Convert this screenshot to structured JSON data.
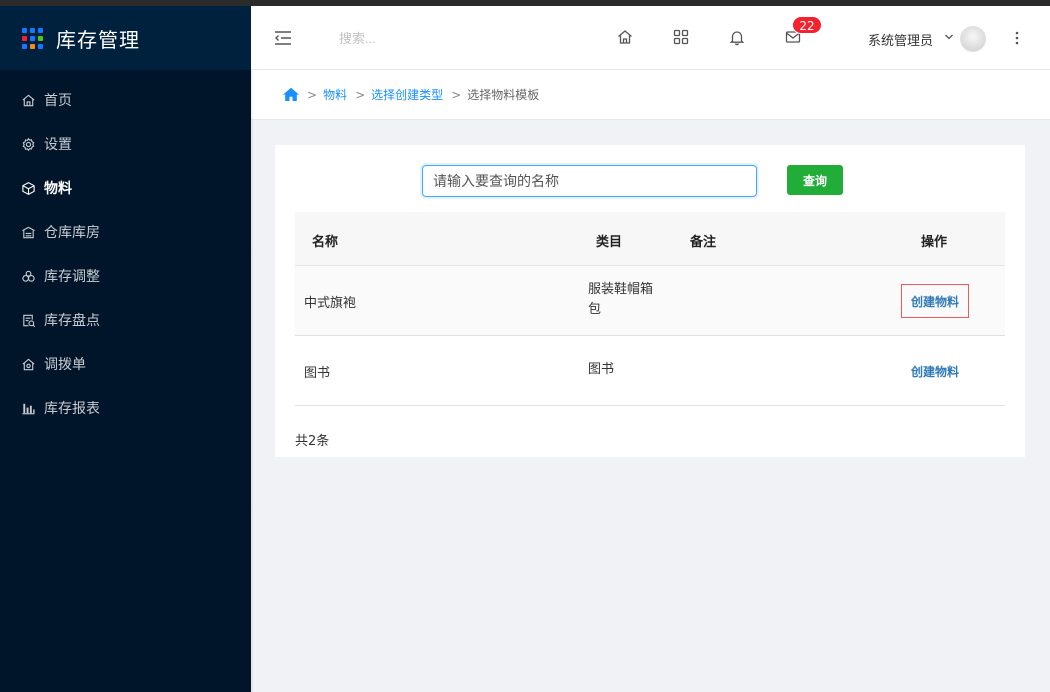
{
  "app": {
    "title": "库存管理",
    "brand_dots": [
      "#1677ff",
      "#1677ff",
      "#1677ff",
      "#f5222d",
      "#1677ff",
      "#52c41a",
      "#1677ff",
      "#fa8c16",
      "#1677ff"
    ]
  },
  "sidebar": {
    "items": [
      {
        "label": "首页",
        "icon": "home-icon",
        "active": false
      },
      {
        "label": "设置",
        "icon": "gear-icon",
        "active": false
      },
      {
        "label": "物料",
        "icon": "cube-icon",
        "active": true
      },
      {
        "label": "仓库库房",
        "icon": "warehouse-icon",
        "active": false
      },
      {
        "label": "库存调整",
        "icon": "adjust-icon",
        "active": false
      },
      {
        "label": "库存盘点",
        "icon": "inventory-check-icon",
        "active": false
      },
      {
        "label": "调拨单",
        "icon": "transfer-icon",
        "active": false
      },
      {
        "label": "库存报表",
        "icon": "bar-chart-icon",
        "active": false
      }
    ]
  },
  "header": {
    "search_placeholder": "搜索...",
    "mail_badge": "22",
    "user_name": "系统管理员"
  },
  "breadcrumb": {
    "items": [
      "物料",
      "选择创建类型"
    ],
    "current": "选择物料模板"
  },
  "query": {
    "placeholder": "请输入要查询的名称",
    "button_label": "查询"
  },
  "table": {
    "columns": [
      "名称",
      "类目",
      "备注",
      "操作"
    ],
    "rows": [
      {
        "name": "中式旗袍",
        "category_line1": "服装鞋帽箱",
        "category_line2": "包",
        "remark": "",
        "action": "创建物料"
      },
      {
        "name": "图书",
        "category_line1": "图书",
        "category_line2": "",
        "remark": "",
        "action": "创建物料"
      }
    ],
    "total": "共2条"
  },
  "colors": {
    "sidebar_bg": "#001529",
    "accent": "#1890ff",
    "query_button": "#22ac38",
    "badge": "#f5222d",
    "action_link": "#2f7ab8"
  }
}
